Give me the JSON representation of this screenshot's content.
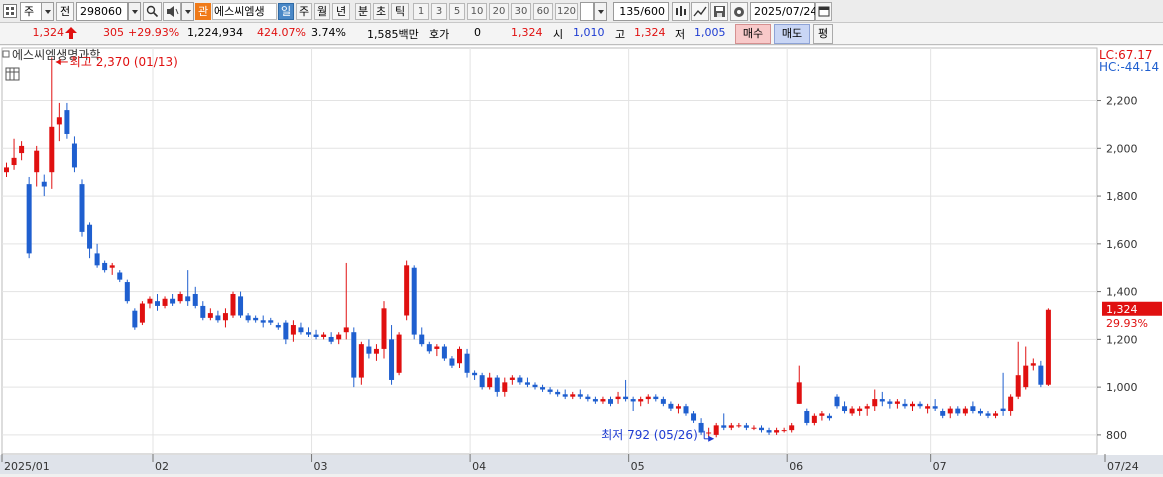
{
  "toolbar": {
    "market": "주",
    "jeon": "전",
    "code": "298060",
    "badge": "관",
    "name": "에스씨엠생",
    "periods": [
      "일",
      "주",
      "월",
      "년",
      "분",
      "초",
      "틱"
    ],
    "numbers": [
      "1",
      "3",
      "5",
      "10",
      "20",
      "30",
      "60",
      "120"
    ],
    "count": "135/600",
    "date": "2025/07/24"
  },
  "quote": {
    "price": "1,324",
    "change": "305",
    "change_pct": "+29.93%",
    "volume": "1,224,934",
    "vol_ratio": "424.07%",
    "turnover": "3.74%",
    "amount": "1,585백만",
    "hoga_label": "호가",
    "hoga": "0",
    "hoga_price": "1,324",
    "open_label": "시",
    "open": "1,010",
    "high_label": "고",
    "high": "1,324",
    "low_label": "저",
    "low": "1,005",
    "buy": "매수",
    "sell": "매도",
    "avg": "평"
  },
  "chart_header": {
    "title": "에스씨엠생명과학",
    "lc": "LC:67.17",
    "hc": "HC:-44.14"
  },
  "chart_data": {
    "type": "candlestick",
    "title": "에스씨엠생명과학",
    "y_ticks": [
      "2,200",
      "2,000",
      "1,800",
      "1,600",
      "1,400",
      "1,200",
      "1,000",
      "800"
    ],
    "ylim": [
      720,
      2420
    ],
    "x_labels": [
      "2025/01",
      "02",
      "03",
      "04",
      "05",
      "06",
      "07",
      "07/24"
    ],
    "x_label_index": [
      0,
      20,
      41,
      62,
      83,
      104,
      123,
      135
    ],
    "annotation_high": "최고 2,370 (01/13)",
    "annotation_low": "최저 792 (05/26)",
    "last_price": "1,324",
    "last_change": "29.93%",
    "ohlc": [
      [
        1900,
        1940,
        1880,
        1920
      ],
      [
        1930,
        2040,
        1910,
        1960
      ],
      [
        1980,
        2030,
        1950,
        2010
      ],
      [
        1850,
        1880,
        1540,
        1560
      ],
      [
        1900,
        2010,
        1840,
        1990
      ],
      [
        1860,
        1890,
        1800,
        1840
      ],
      [
        1900,
        2380,
        1830,
        2090
      ],
      [
        2100,
        2190,
        2030,
        2130
      ],
      [
        2160,
        2190,
        2040,
        2060
      ],
      [
        2020,
        2050,
        1900,
        1920
      ],
      [
        1850,
        1870,
        1630,
        1650
      ],
      [
        1680,
        1690,
        1540,
        1580
      ],
      [
        1560,
        1600,
        1500,
        1510
      ],
      [
        1520,
        1530,
        1480,
        1490
      ],
      [
        1500,
        1520,
        1470,
        1510
      ],
      [
        1480,
        1490,
        1440,
        1450
      ],
      [
        1440,
        1450,
        1350,
        1360
      ],
      [
        1320,
        1330,
        1240,
        1250
      ],
      [
        1270,
        1360,
        1260,
        1350
      ],
      [
        1350,
        1380,
        1330,
        1370
      ],
      [
        1360,
        1390,
        1320,
        1340
      ],
      [
        1340,
        1380,
        1330,
        1370
      ],
      [
        1370,
        1390,
        1340,
        1350
      ],
      [
        1360,
        1400,
        1350,
        1390
      ],
      [
        1380,
        1490,
        1340,
        1360
      ],
      [
        1390,
        1420,
        1330,
        1340
      ],
      [
        1340,
        1360,
        1280,
        1290
      ],
      [
        1290,
        1330,
        1280,
        1310
      ],
      [
        1300,
        1320,
        1270,
        1280
      ],
      [
        1280,
        1330,
        1250,
        1310
      ],
      [
        1300,
        1400,
        1290,
        1390
      ],
      [
        1380,
        1400,
        1290,
        1300
      ],
      [
        1300,
        1310,
        1270,
        1280
      ],
      [
        1290,
        1300,
        1270,
        1280
      ],
      [
        1280,
        1300,
        1250,
        1270
      ],
      [
        1280,
        1290,
        1260,
        1270
      ],
      [
        1260,
        1270,
        1240,
        1250
      ],
      [
        1270,
        1280,
        1180,
        1200
      ],
      [
        1220,
        1280,
        1190,
        1260
      ],
      [
        1250,
        1270,
        1220,
        1230
      ],
      [
        1230,
        1250,
        1210,
        1220
      ],
      [
        1220,
        1240,
        1200,
        1210
      ],
      [
        1210,
        1230,
        1200,
        1220
      ],
      [
        1210,
        1230,
        1180,
        1190
      ],
      [
        1200,
        1230,
        1180,
        1220
      ],
      [
        1230,
        1520,
        1200,
        1250
      ],
      [
        1230,
        1250,
        1000,
        1040
      ],
      [
        1040,
        1190,
        1010,
        1180
      ],
      [
        1170,
        1200,
        1120,
        1140
      ],
      [
        1140,
        1180,
        1110,
        1160
      ],
      [
        1160,
        1360,
        1120,
        1330
      ],
      [
        1200,
        1260,
        1010,
        1030
      ],
      [
        1060,
        1230,
        1050,
        1220
      ],
      [
        1300,
        1530,
        1280,
        1510
      ],
      [
        1500,
        1510,
        1200,
        1220
      ],
      [
        1220,
        1250,
        1170,
        1180
      ],
      [
        1180,
        1190,
        1140,
        1150
      ],
      [
        1160,
        1180,
        1130,
        1170
      ],
      [
        1170,
        1180,
        1110,
        1120
      ],
      [
        1120,
        1130,
        1080,
        1090
      ],
      [
        1100,
        1170,
        1080,
        1160
      ],
      [
        1140,
        1160,
        1040,
        1060
      ],
      [
        1060,
        1070,
        1030,
        1050
      ],
      [
        1050,
        1060,
        990,
        1000
      ],
      [
        1000,
        1060,
        990,
        1040
      ],
      [
        1040,
        1050,
        960,
        980
      ],
      [
        980,
        1040,
        960,
        1020
      ],
      [
        1030,
        1050,
        1010,
        1040
      ],
      [
        1040,
        1050,
        1010,
        1020
      ],
      [
        1020,
        1040,
        1000,
        1010
      ],
      [
        1010,
        1020,
        990,
        1000
      ],
      [
        1000,
        1010,
        980,
        990
      ],
      [
        990,
        1000,
        970,
        980
      ],
      [
        980,
        990,
        960,
        970
      ],
      [
        970,
        990,
        950,
        960
      ],
      [
        960,
        980,
        950,
        970
      ],
      [
        970,
        990,
        950,
        960
      ],
      [
        960,
        970,
        940,
        950
      ],
      [
        950,
        960,
        930,
        940
      ],
      [
        940,
        960,
        930,
        950
      ],
      [
        950,
        960,
        920,
        930
      ],
      [
        950,
        980,
        930,
        960
      ],
      [
        960,
        1030,
        940,
        950
      ],
      [
        950,
        960,
        900,
        940
      ],
      [
        940,
        960,
        920,
        950
      ],
      [
        950,
        970,
        930,
        960
      ],
      [
        960,
        970,
        940,
        950
      ],
      [
        950,
        960,
        920,
        930
      ],
      [
        930,
        940,
        900,
        910
      ],
      [
        910,
        930,
        890,
        920
      ],
      [
        920,
        930,
        880,
        890
      ],
      [
        890,
        900,
        850,
        860
      ],
      [
        850,
        870,
        800,
        810
      ],
      [
        810,
        830,
        790,
        810
      ],
      [
        800,
        850,
        790,
        840
      ],
      [
        840,
        890,
        820,
        830
      ],
      [
        830,
        850,
        820,
        840
      ],
      [
        840,
        850,
        830,
        840
      ],
      [
        840,
        850,
        820,
        830
      ],
      [
        830,
        840,
        820,
        830
      ],
      [
        830,
        840,
        810,
        820
      ],
      [
        820,
        830,
        800,
        810
      ],
      [
        810,
        830,
        800,
        820
      ],
      [
        820,
        830,
        810,
        820
      ],
      [
        820,
        850,
        810,
        840
      ],
      [
        930,
        1090,
        930,
        1020
      ],
      [
        900,
        910,
        840,
        850
      ],
      [
        850,
        890,
        840,
        880
      ],
      [
        880,
        900,
        860,
        890
      ],
      [
        880,
        890,
        860,
        870
      ],
      [
        960,
        970,
        910,
        920
      ],
      [
        920,
        940,
        890,
        900
      ],
      [
        890,
        920,
        880,
        910
      ],
      [
        900,
        920,
        880,
        910
      ],
      [
        910,
        930,
        880,
        920
      ],
      [
        920,
        990,
        900,
        950
      ],
      [
        950,
        980,
        920,
        940
      ],
      [
        940,
        950,
        910,
        930
      ],
      [
        930,
        950,
        910,
        940
      ],
      [
        930,
        950,
        910,
        920
      ],
      [
        920,
        940,
        900,
        930
      ],
      [
        930,
        940,
        910,
        920
      ],
      [
        910,
        930,
        890,
        920
      ],
      [
        920,
        950,
        900,
        910
      ],
      [
        900,
        910,
        870,
        880
      ],
      [
        890,
        920,
        870,
        910
      ],
      [
        910,
        920,
        880,
        890
      ],
      [
        890,
        920,
        880,
        910
      ],
      [
        920,
        940,
        890,
        900
      ],
      [
        900,
        910,
        880,
        890
      ],
      [
        890,
        900,
        870,
        880
      ],
      [
        880,
        900,
        870,
        890
      ],
      [
        910,
        1060,
        880,
        900
      ],
      [
        900,
        970,
        880,
        960
      ],
      [
        960,
        1190,
        950,
        1050
      ],
      [
        1000,
        1170,
        990,
        1090
      ],
      [
        1090,
        1120,
        1070,
        1100
      ],
      [
        1090,
        1110,
        1000,
        1010
      ],
      [
        1010,
        1330,
        1005,
        1324
      ]
    ]
  }
}
